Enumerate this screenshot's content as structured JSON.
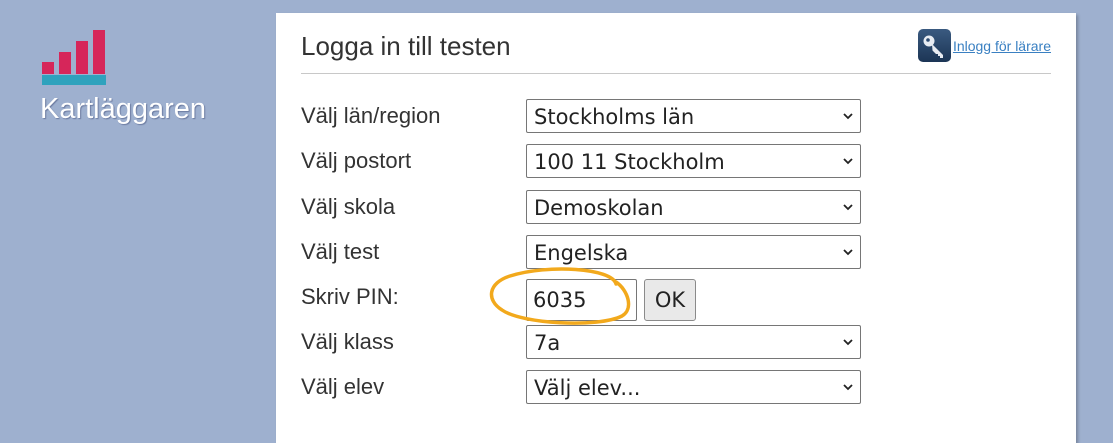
{
  "logo": {
    "text": "Kartläggaren"
  },
  "panel": {
    "title": "Logga in till testen",
    "teacher_login_label": "Inlogg för lärare"
  },
  "form": {
    "region": {
      "label": "Välj län/region",
      "value": "Stockholms län"
    },
    "postort": {
      "label": "Välj postort",
      "value": "100 11 Stockholm"
    },
    "school": {
      "label": "Välj skola",
      "value": "Demoskolan"
    },
    "test": {
      "label": "Välj test",
      "value": "Engelska"
    },
    "pin": {
      "label": "Skriv PIN:",
      "value": "6035",
      "button_label": "OK"
    },
    "class": {
      "label": "Välj klass",
      "value": "7a"
    },
    "student": {
      "label": "Välj elev",
      "value": "Välj elev..."
    }
  },
  "colors": {
    "background": "#9eb0cf",
    "logo_bars": "#d6265a",
    "logo_base": "#2fa2bd",
    "link": "#3a80c2",
    "highlight": "#f2a91c"
  },
  "icons": {
    "teacher_login": "key-icon",
    "dropdown": "chevron-down-icon"
  }
}
